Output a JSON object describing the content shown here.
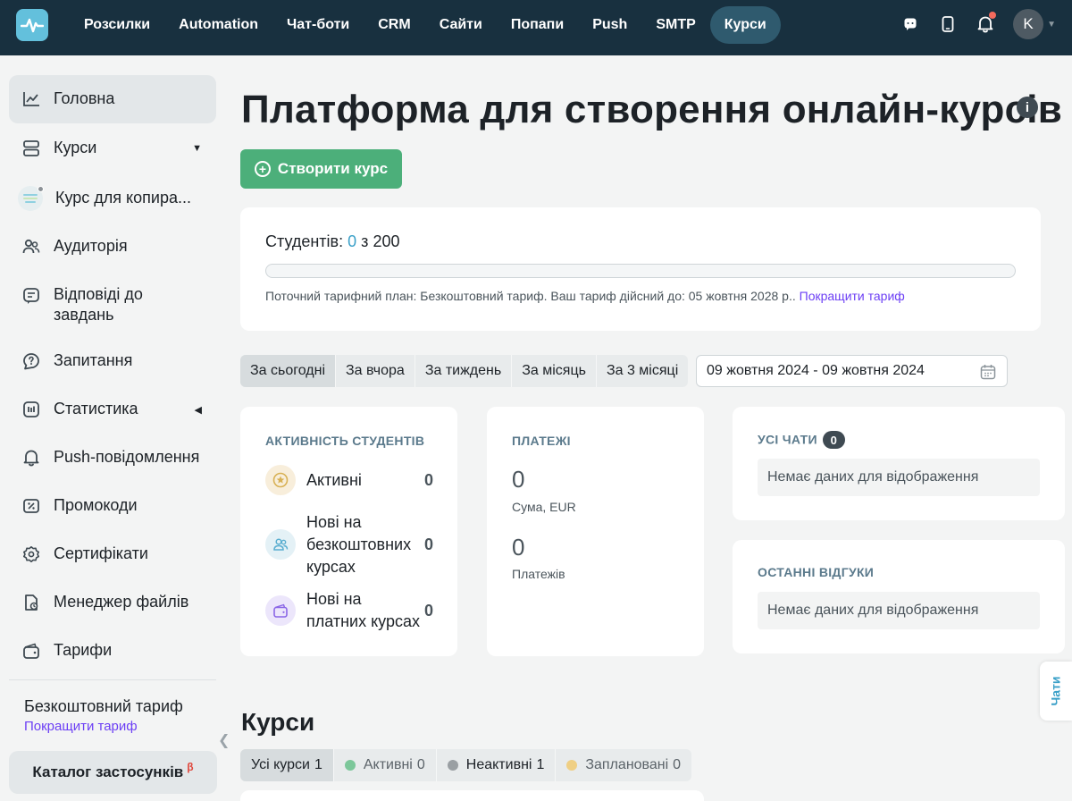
{
  "topnav": {
    "items": [
      {
        "label": "Розсилки",
        "active": false
      },
      {
        "label": "Automation",
        "active": false
      },
      {
        "label": "Чат-боти",
        "active": false
      },
      {
        "label": "CRM",
        "active": false
      },
      {
        "label": "Сайти",
        "active": false
      },
      {
        "label": "Попапи",
        "active": false
      },
      {
        "label": "Push",
        "active": false
      },
      {
        "label": "SMTP",
        "active": false
      },
      {
        "label": "Курси",
        "active": true
      }
    ],
    "icons": [
      "chat-icon",
      "mobile-icon",
      "bell-icon"
    ],
    "avatar_letter": "K",
    "notification_dot_color": "#f36a5d"
  },
  "sidebar": {
    "items": [
      {
        "label": "Головна",
        "icon": "chart-line-icon",
        "active": true
      },
      {
        "label": "Курси",
        "icon": "courses-icon",
        "caret": "down"
      },
      {
        "label": "Курс для копира...",
        "icon": "course-thumb"
      },
      {
        "label": "Аудиторія",
        "icon": "users-icon"
      },
      {
        "label": "Відповіді до завдань",
        "icon": "answers-icon"
      },
      {
        "label": "Запитання",
        "icon": "question-icon"
      },
      {
        "label": "Статистика",
        "icon": "stats-icon",
        "caret": "left"
      },
      {
        "label": "Push-повідомлення",
        "icon": "bell-icon"
      },
      {
        "label": "Промокоди",
        "icon": "promo-icon"
      },
      {
        "label": "Сертифікати",
        "icon": "certificate-icon"
      },
      {
        "label": "Менеджер файлів",
        "icon": "file-manager-icon"
      },
      {
        "label": "Тарифи",
        "icon": "wallet-icon"
      }
    ],
    "plan_name": "Безкоштовний тариф",
    "plan_upgrade": "Покращити тариф",
    "catalog_label": "Каталог застосунків",
    "catalog_badge": "β"
  },
  "main": {
    "title": "Платформа для створення онлайн-курсів",
    "info_icon": "i",
    "create_button": "Створити курс",
    "students": {
      "label": "Студентів:",
      "current": "0",
      "sep": "з",
      "limit": "200",
      "progress": 0,
      "plan_text": "Поточний тарифний план: Безкоштовний тариф. Ваш тариф дійсний до: 05 жовтня 2028 р..",
      "upgrade_link": "Покращити тариф"
    },
    "filters": [
      {
        "label": "За сьогодні",
        "active": true
      },
      {
        "label": "За вчора",
        "active": false
      },
      {
        "label": "За тиждень",
        "active": false
      },
      {
        "label": "За місяць",
        "active": false
      },
      {
        "label": "За 3 місяці",
        "active": false
      }
    ],
    "date_range": "09 жовтня 2024 - 09 жовтня 2024",
    "activity": {
      "title": "АКТИВНІСТЬ СТУДЕНТІВ",
      "rows": [
        {
          "label": "Активні",
          "value": "0",
          "icon": "star-badge-icon",
          "color": "#f8eedb"
        },
        {
          "label": "Нові на безкоштовних курсах",
          "value": "0",
          "icon": "users-icon",
          "color": "#e4f1f6"
        },
        {
          "label": "Нові на платних курсах",
          "value": "0",
          "icon": "wallet-icon",
          "color": "#ece6fb"
        }
      ]
    },
    "payments": {
      "title": "ПЛАТЕЖІ",
      "sum_value": "0",
      "sum_label": "Сума, EUR",
      "count_value": "0",
      "count_label": "Платежів"
    },
    "chats": {
      "title": "УСІ ЧАТИ",
      "count": "0",
      "empty": "Немає даних для відображення"
    },
    "reviews": {
      "title": "ОСТАННІ ВІДГУКИ",
      "empty": "Немає даних для відображення"
    },
    "chat_tab": "Чати",
    "courses": {
      "title": "Курси",
      "tabs": [
        {
          "label": "Усі курси",
          "count": "1",
          "active": true,
          "dot": ""
        },
        {
          "label": "Активні",
          "count": "0",
          "active": false,
          "dot": "#7cc79a"
        },
        {
          "label": "Неактивні",
          "count": "1",
          "active": false,
          "dot": "#9a9fa3"
        },
        {
          "label": "Заплановані",
          "count": "0",
          "active": false,
          "dot": "#efcf84"
        }
      ]
    }
  },
  "colors": {
    "topbar": "#18303f",
    "accent_green": "#4caf7a",
    "accent_blue": "#3aa0c8",
    "link_purple": "#6c3ff5"
  }
}
